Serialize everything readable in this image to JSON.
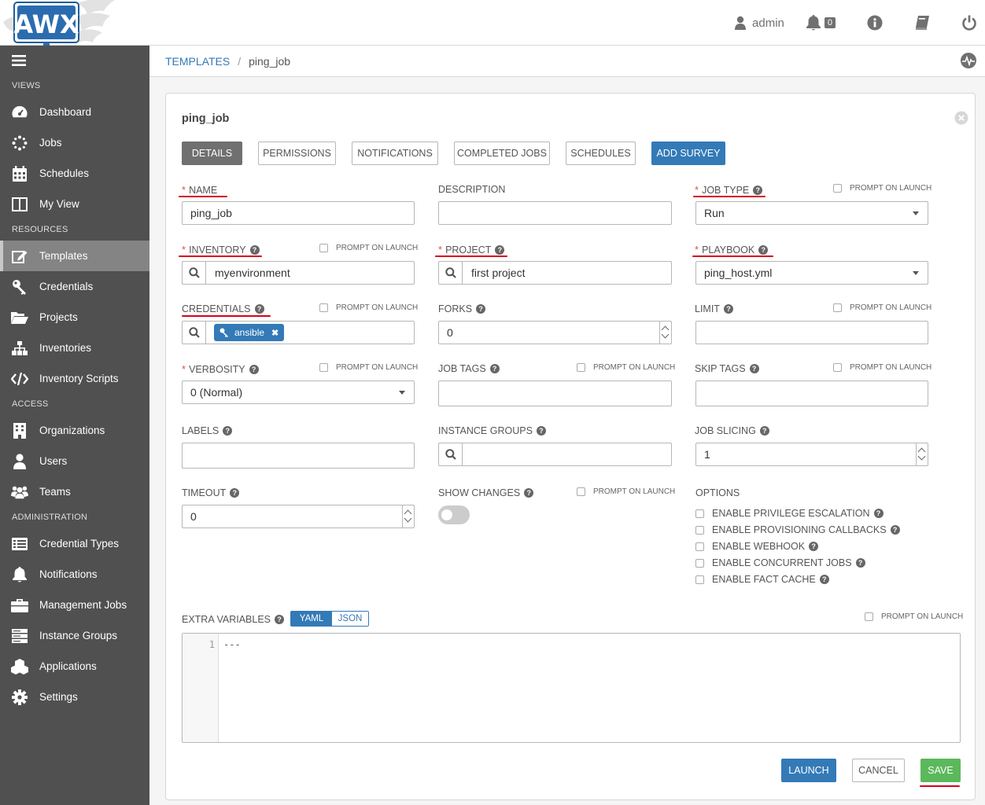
{
  "app": {
    "logo_text": "AWX"
  },
  "header": {
    "user": "admin",
    "notification_count": "0"
  },
  "sidebar": {
    "sections": [
      {
        "title": "VIEWS",
        "items": [
          {
            "label": "Dashboard",
            "icon": "tachometer-icon"
          },
          {
            "label": "Jobs",
            "icon": "spinner-icon"
          },
          {
            "label": "Schedules",
            "icon": "calendar-icon"
          },
          {
            "label": "My View",
            "icon": "columns-icon"
          }
        ]
      },
      {
        "title": "RESOURCES",
        "items": [
          {
            "label": "Templates",
            "icon": "edit-icon",
            "active": true
          },
          {
            "label": "Credentials",
            "icon": "key-icon"
          },
          {
            "label": "Projects",
            "icon": "folder-open-icon"
          },
          {
            "label": "Inventories",
            "icon": "sitemap-icon"
          },
          {
            "label": "Inventory Scripts",
            "icon": "code-icon"
          }
        ]
      },
      {
        "title": "ACCESS",
        "items": [
          {
            "label": "Organizations",
            "icon": "building-icon"
          },
          {
            "label": "Users",
            "icon": "user-icon"
          },
          {
            "label": "Teams",
            "icon": "users-icon"
          }
        ]
      },
      {
        "title": "ADMINISTRATION",
        "items": [
          {
            "label": "Credential Types",
            "icon": "list-alt-icon"
          },
          {
            "label": "Notifications",
            "icon": "bell-icon"
          },
          {
            "label": "Management Jobs",
            "icon": "briefcase-icon"
          },
          {
            "label": "Instance Groups",
            "icon": "server-icon"
          },
          {
            "label": "Applications",
            "icon": "cubes-icon"
          },
          {
            "label": "Settings",
            "icon": "cog-icon"
          }
        ]
      }
    ]
  },
  "breadcrumb": {
    "parent": "TEMPLATES",
    "separator": "/",
    "current": "ping_job"
  },
  "panel": {
    "title": "ping_job",
    "tabs": [
      "DETAILS",
      "PERMISSIONS",
      "NOTIFICATIONS",
      "COMPLETED JOBS",
      "SCHEDULES",
      "ADD SURVEY"
    ]
  },
  "form": {
    "prompt_on_launch": "PROMPT ON LAUNCH",
    "name": {
      "label": "NAME",
      "value": "ping_job"
    },
    "description": {
      "label": "DESCRIPTION",
      "value": ""
    },
    "job_type": {
      "label": "JOB TYPE",
      "value": "Run"
    },
    "inventory": {
      "label": "INVENTORY",
      "value": "myenvironment"
    },
    "project": {
      "label": "PROJECT",
      "value": "first project"
    },
    "playbook": {
      "label": "PLAYBOOK",
      "value": "ping_host.yml"
    },
    "credentials": {
      "label": "CREDENTIALS",
      "chip": "ansible"
    },
    "forks": {
      "label": "FORKS",
      "value": "0"
    },
    "limit": {
      "label": "LIMIT",
      "value": ""
    },
    "verbosity": {
      "label": "VERBOSITY",
      "value": "0 (Normal)"
    },
    "job_tags": {
      "label": "JOB TAGS",
      "value": ""
    },
    "skip_tags": {
      "label": "SKIP TAGS",
      "value": ""
    },
    "labels": {
      "label": "LABELS",
      "value": ""
    },
    "instance_groups": {
      "label": "INSTANCE GROUPS",
      "value": ""
    },
    "job_slicing": {
      "label": "JOB SLICING",
      "value": "1"
    },
    "timeout": {
      "label": "TIMEOUT",
      "value": "0"
    },
    "show_changes": {
      "label": "SHOW CHANGES",
      "enabled": false
    },
    "options": {
      "label": "OPTIONS",
      "items": [
        "ENABLE PRIVILEGE ESCALATION",
        "ENABLE PROVISIONING CALLBACKS",
        "ENABLE WEBHOOK",
        "ENABLE CONCURRENT JOBS",
        "ENABLE FACT CACHE"
      ]
    },
    "extra_variables": {
      "label": "EXTRA VARIABLES",
      "modes": [
        "YAML",
        "JSON"
      ],
      "active_mode": "YAML",
      "line_number": "1",
      "code": "---"
    }
  },
  "actions": {
    "launch": "LAUNCH",
    "cancel": "CANCEL",
    "save": "SAVE"
  },
  "colors": {
    "primary": "#337ab7",
    "success": "#5cb85c",
    "sidebar": "#505050",
    "annotation_red": "#d9001b",
    "required": "#d9534f"
  }
}
